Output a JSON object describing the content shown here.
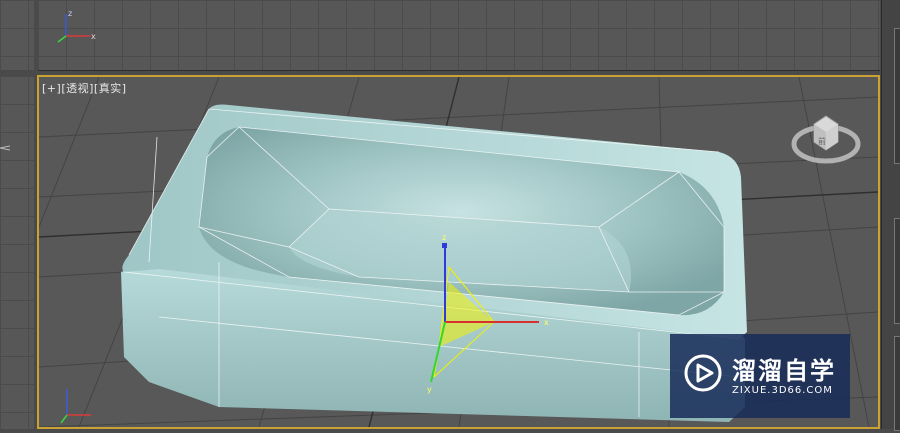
{
  "viewport": {
    "label_plus": "[+]",
    "label_view": "[透视]",
    "label_shading": "[真实]"
  },
  "axis": {
    "x": "x",
    "y": "y",
    "z": "z"
  },
  "viewcube": {
    "face": "前"
  },
  "watermark": {
    "title": "溜溜自学",
    "url": "ZIXUE.3D66.COM"
  },
  "colors": {
    "selection_border": "#c9a231",
    "tub_color": "#a9cfcf",
    "gizmo_yellow": "#f2f200",
    "watermark_bg": "#182c58"
  }
}
